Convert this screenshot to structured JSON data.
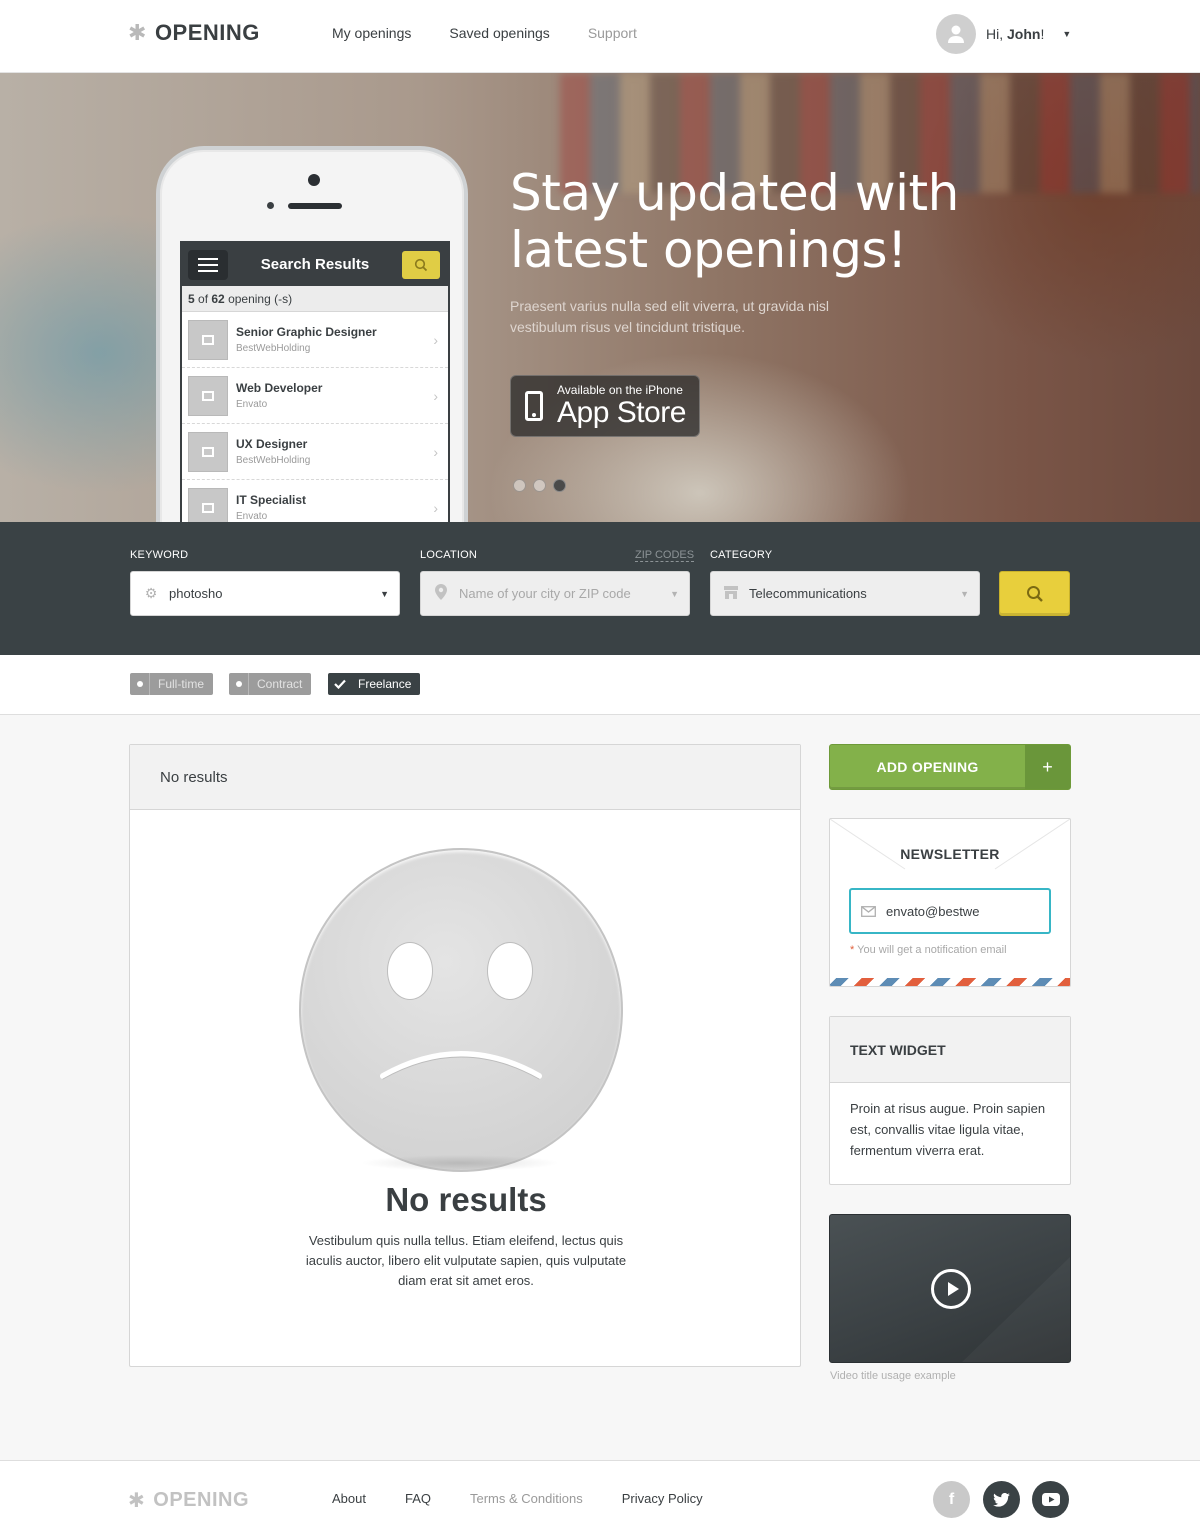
{
  "header": {
    "logo": "OPENING",
    "nav": [
      {
        "label": "My openings"
      },
      {
        "label": "Saved openings"
      },
      {
        "label": "Support"
      }
    ],
    "user": {
      "greeting": "Hi, ",
      "name": "John",
      "suffix": "!"
    }
  },
  "hero": {
    "title": "Stay updated with latest openings!",
    "subtitle": "Praesent varius nulla sed elit viverra, ut gravida nisl vestibulum risus vel tincidunt tristique.",
    "app_store": {
      "small": "Available on the iPhone",
      "big": "App Store"
    },
    "slider": {
      "count": 3,
      "active_index": 2
    },
    "phone": {
      "title": "Search Results",
      "count_shown": "5",
      "count_of": " of ",
      "count_total": "62",
      "count_suffix": " opening (-s)",
      "results": [
        {
          "title": "Senior Graphic Designer",
          "company": "BestWebHolding"
        },
        {
          "title": "Web Developer",
          "company": "Envato"
        },
        {
          "title": "UX Designer",
          "company": "BestWebHolding"
        },
        {
          "title": "IT Specialist",
          "company": "Envato"
        }
      ]
    }
  },
  "search": {
    "keyword": {
      "label": "KEYWORD",
      "value": "photosho"
    },
    "location": {
      "label": "LOCATION",
      "zip_link": "ZIP CODES",
      "placeholder": "Name of your city or ZIP code"
    },
    "category": {
      "label": "CATEGORY",
      "value": "Telecommunications"
    }
  },
  "filters": [
    {
      "label": "Full-time",
      "checked": false
    },
    {
      "label": "Contract",
      "checked": false
    },
    {
      "label": "Freelance",
      "checked": true
    }
  ],
  "results": {
    "header": "No results",
    "title": "No results",
    "text": "Vestibulum quis nulla tellus. Etiam eleifend, lectus quis iaculis auctor, libero elit vulputate sapien, quis vulputate diam erat sit amet eros."
  },
  "sidebar": {
    "add_opening": {
      "label": "ADD OPENING",
      "icon": "+"
    },
    "newsletter": {
      "title": "NEWSLETTER",
      "email": "envato@bestwe",
      "note_marker": "*",
      "note": " You will get a notification email"
    },
    "text_widget": {
      "title": "TEXT WIDGET",
      "body": "Proin at risus augue. Proin sapien est, convallis vitae ligula vitae, fermentum viverra erat."
    },
    "video": {
      "caption": "Video title usage example"
    }
  },
  "footer": {
    "logo": "OPENING",
    "links": [
      {
        "label": "About"
      },
      {
        "label": "FAQ"
      },
      {
        "label": "Terms & Conditions"
      },
      {
        "label": "Privacy Policy"
      }
    ],
    "social": [
      {
        "icon": "facebook-icon",
        "glyph": "f",
        "color": "#c9c9c9"
      },
      {
        "icon": "twitter-icon",
        "glyph": "t",
        "color": "#3a4245"
      },
      {
        "icon": "youtube-icon",
        "glyph": "▶",
        "color": "#3a4245"
      }
    ]
  },
  "colors": {
    "accent_yellow": "#e8cf3c",
    "accent_green": "#83b14a",
    "dark": "#3a4245",
    "focus": "#37b6c6"
  }
}
